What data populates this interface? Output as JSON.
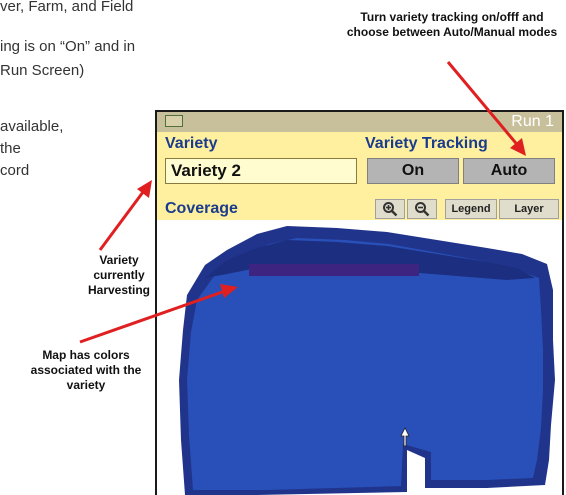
{
  "document": {
    "lines": [
      "ver, Farm, and Field",
      "ing is on “On”  and in",
      "Run Screen)",
      "available,",
      "the",
      "cord"
    ]
  },
  "callouts": {
    "tracking": "Turn variety tracking on/offf and choose between Auto/Manual modes",
    "variety": "Variety currently Harvesting",
    "map": "Map has colors associated with the variety"
  },
  "screen": {
    "run_label": "Run 1",
    "variety_label": "Variety",
    "variety_value": "Variety 2",
    "tracking_label": "Variety Tracking",
    "on_label": "On",
    "auto_label": "Auto",
    "coverage_label": "Coverage",
    "legend_label": "Legend",
    "layer_label": "Layer"
  },
  "icons": [
    "monitor-icon",
    "zoom-in-icon",
    "zoom-out-icon",
    "heading-arrow-icon"
  ],
  "colors": {
    "label_blue": "#1a3c8c",
    "panel_yellow": "#fff0a0",
    "title_bar": "#c8c09a",
    "callout_arrow": "#e02020",
    "field_dark": "#20348c",
    "field_mid": "#2850b8",
    "harvest_strip": "#3c2480"
  }
}
